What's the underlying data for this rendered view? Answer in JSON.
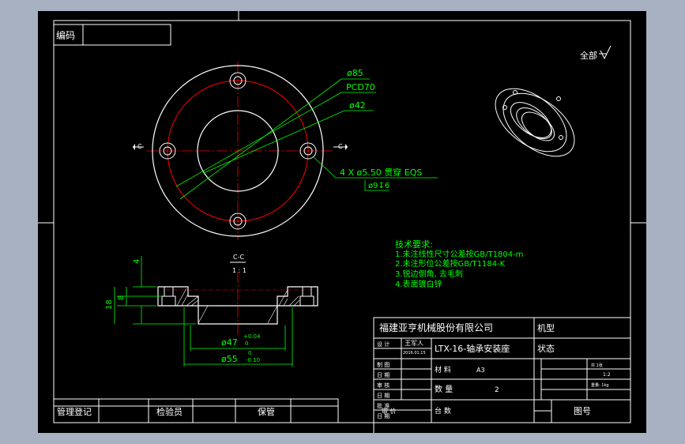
{
  "colors": {
    "background": "#a7b1c2",
    "sheet": "#000000",
    "line": "#ffffff",
    "dimension": "#00ff00",
    "centerline": "#ff0000"
  },
  "corner": {
    "code_label": "编码"
  },
  "roughness": {
    "label": "全部"
  },
  "front_view": {
    "outer_dia": "ø85",
    "pcd": "PCD70",
    "inner_dia": "ø42",
    "holes": "4 X ø5.50 贯穿 EQS",
    "counterbore": "ø9↧6",
    "section_mark": "C"
  },
  "section_view": {
    "title": "C-C",
    "scale": "1 : 1",
    "dim_thickness": "4",
    "dim_flange": "8",
    "dim_height": "18",
    "bore_dia": "ø47",
    "bore_tol_upper": "+0.04",
    "bore_tol_lower": "0",
    "outer_dia": "ø55",
    "outer_tol_upper": "0",
    "outer_tol_lower": "-0.10"
  },
  "notes": {
    "title": "技术要求:",
    "items": [
      "1.未注线性尺寸公差按GB/T1804-m",
      "2.未注形位公差按GB/T1184-K",
      "3.锐边倒角, 去毛刺",
      "4.表面镀白锌"
    ]
  },
  "title_block": {
    "company": "福建亚亨机械股份有限公司",
    "machine_label": "机型",
    "status_label": "状态",
    "design_label": "设 计",
    "designer": "王军人",
    "design_date": "2016.01.15",
    "part_name": "LTX-16-轴承安装座",
    "draw_label": "制 图",
    "date_label": "日 期",
    "material_label": "材 料",
    "material": "A3",
    "check_label": "审 核",
    "quantity_label": "数 量",
    "quantity": "2",
    "approve_label": "批 准",
    "process_label": "审 价",
    "sets_label": "台 数",
    "drawing_no_label": "图号",
    "sheet_label": "共 1张",
    "scale": "1:2",
    "weight": "重量: 1kg"
  },
  "bottom_block": {
    "register": "管理登记",
    "inspector": "检验员",
    "custody": "保管"
  }
}
